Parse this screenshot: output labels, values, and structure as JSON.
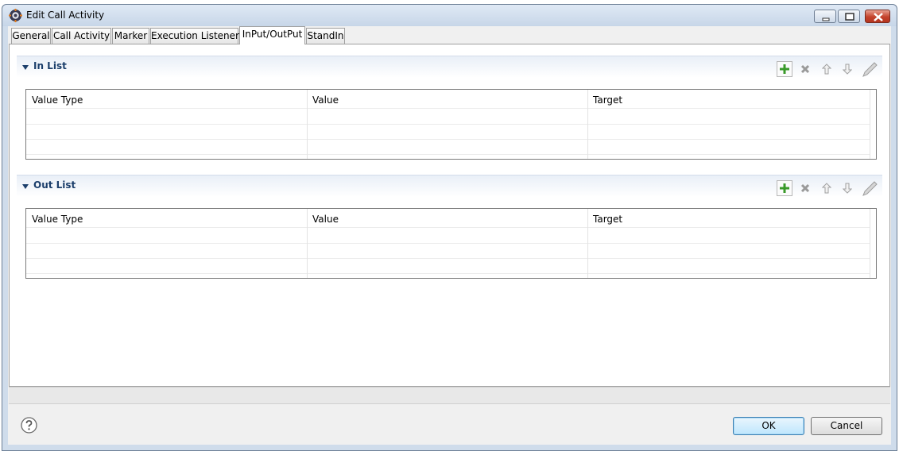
{
  "window": {
    "title": "Edit Call Activity"
  },
  "tabs": [
    {
      "label": "General"
    },
    {
      "label": "Call Activity"
    },
    {
      "label": "Marker"
    },
    {
      "label": "Execution Listeners"
    },
    {
      "label": "InPut/OutPut"
    },
    {
      "label": "StandIn"
    }
  ],
  "active_tab": "InPut/OutPut",
  "in_list": {
    "title": "In List",
    "columns": [
      "Value Type",
      "Value",
      "Target"
    ],
    "rows": []
  },
  "out_list": {
    "title": "Out List",
    "columns": [
      "Value Type",
      "Value",
      "Target"
    ],
    "rows": []
  },
  "toolbar_icons": [
    "add-icon",
    "delete-icon",
    "move-up-icon",
    "move-down-icon",
    "edit-icon"
  ],
  "buttons": {
    "ok": "OK",
    "cancel": "Cancel"
  },
  "colors": {
    "section_title": "#1c3f6b",
    "add_icon": "#3a9a2a",
    "ok_border": "#3c7fb1"
  }
}
